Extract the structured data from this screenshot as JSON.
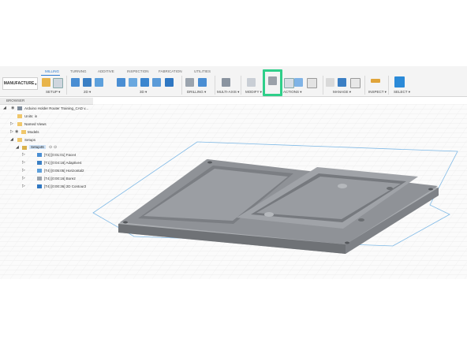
{
  "workspace": {
    "label": "MANUFACTURE"
  },
  "tabs": [
    {
      "label": "MILLING"
    },
    {
      "label": "TURNING"
    },
    {
      "label": "ADDITIVE"
    },
    {
      "label": "INSPECTION"
    },
    {
      "label": "FABRICATION"
    },
    {
      "label": "UTILITIES"
    }
  ],
  "toolbar_groups": [
    {
      "label": "SETUP"
    },
    {
      "label": "2D"
    },
    {
      "label": "3D"
    },
    {
      "label": "DRILLING"
    },
    {
      "label": "MULTI-AXIS"
    },
    {
      "label": "MODIFY"
    },
    {
      "label": "ACTIONS"
    },
    {
      "label": "MANAGE"
    },
    {
      "label": "INSPECT"
    },
    {
      "label": "SELECT"
    }
  ],
  "browser": {
    "title": "BROWSER",
    "document": "Arduino Holder Router Training_CAD v...",
    "units": "Units: in",
    "named_views": "Named Views",
    "models": "Models",
    "setups": "Setups",
    "setup_name": "Setup46",
    "operations": [
      "[T3] [0:01:01] Face4",
      "[T1] [0:04:16] Adaptive4",
      "[T4] [0:05:05] Horizontal2",
      "[T4] [0:00:16] Bore2",
      "[T4] [0:00:36] 2D Contour2"
    ]
  },
  "colors": {
    "accent": "#2b7bd0",
    "highlight": "#2fcf8a",
    "part": "#8e9196",
    "stock_outline": "#7fb9e6"
  },
  "icons": [
    "eye-icon",
    "gear-icon",
    "setup-icon",
    "toolpath-icon"
  ]
}
